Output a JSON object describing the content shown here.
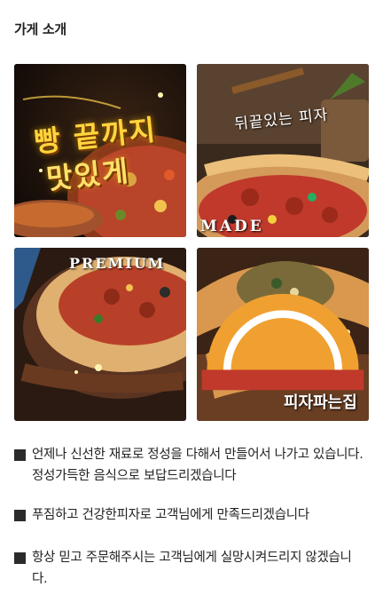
{
  "section": {
    "title": "가게 소개"
  },
  "gallery": {
    "tiles": [
      {
        "name": "pizza-edge-promo",
        "caption_line1": "빵 끝까지",
        "caption_line2": "맛있게"
      },
      {
        "name": "stuffed-crust-promo",
        "caption": "뒤끝있는 피자",
        "stamp": "MADE"
      },
      {
        "name": "premium-pizza",
        "caption": "PREMIUM"
      },
      {
        "name": "calzone-brand",
        "brand": "피자파는집"
      }
    ]
  },
  "notes": [
    "언제나 신선한 재료로 정성을 다해서 만들어서 나가고 있습니다. 정성가득한 음식으로 보답드리겠습니다",
    "푸짐하고 건강한피자로 고객님에게 만족드리겠습니다",
    "항상 믿고 주문해주시는 고객님에게 실망시켜드리지 않겠습니다."
  ]
}
